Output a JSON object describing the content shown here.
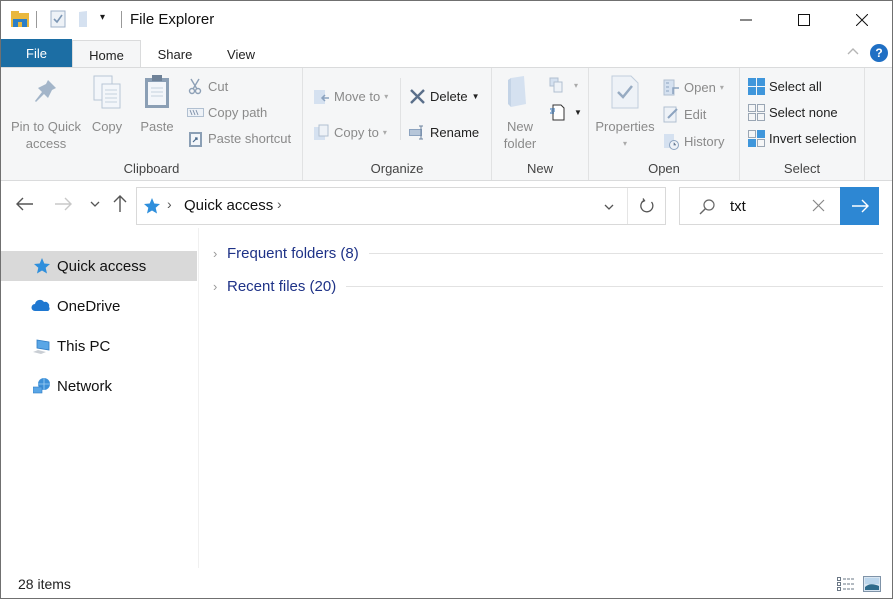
{
  "window": {
    "title": "File Explorer",
    "controls": {
      "minimize": "—",
      "maximize": "☐",
      "close": "✕"
    }
  },
  "quick_access_toolbar": {
    "items": [
      "properties-icon",
      "new-folder-icon",
      "customize-dropdown"
    ]
  },
  "tabs": {
    "file": "File",
    "home": "Home",
    "share": "Share",
    "view": "View",
    "active": "Home"
  },
  "ribbon": {
    "clipboard": {
      "label": "Clipboard",
      "pin": "Pin to Quick access",
      "pin_line1": "Pin to Quick",
      "pin_line2": "access",
      "copy": "Copy",
      "paste": "Paste",
      "cut": "Cut",
      "copy_path": "Copy path",
      "paste_shortcut": "Paste shortcut"
    },
    "organize": {
      "label": "Organize",
      "move_to": "Move to",
      "copy_to": "Copy to",
      "delete": "Delete",
      "rename": "Rename"
    },
    "new": {
      "label": "New",
      "new_folder_line1": "New",
      "new_folder_line2": "folder"
    },
    "open": {
      "label": "Open",
      "properties": "Properties",
      "open": "Open",
      "edit": "Edit",
      "history": "History"
    },
    "select": {
      "label": "Select",
      "select_all": "Select all",
      "select_none": "Select none",
      "invert_selection": "Invert selection"
    }
  },
  "navigation": {
    "back": "←",
    "forward": "→",
    "recent": "⌄",
    "up": "↑",
    "address": {
      "segments": [
        "Quick access"
      ]
    },
    "refresh": "↻",
    "search": {
      "value": "txt",
      "clear": "✕",
      "go": "→"
    }
  },
  "sidebar": {
    "items": [
      {
        "label": "Quick access",
        "icon": "star-icon",
        "selected": true
      },
      {
        "label": "OneDrive",
        "icon": "cloud-icon",
        "selected": false
      },
      {
        "label": "This PC",
        "icon": "computer-icon",
        "selected": false
      },
      {
        "label": "Network",
        "icon": "network-icon",
        "selected": false
      }
    ]
  },
  "content": {
    "sections": [
      {
        "label": "Frequent folders (8)"
      },
      {
        "label": "Recent files (20)"
      }
    ]
  },
  "status": {
    "item_count": "28 items"
  },
  "colors": {
    "file_tab": "#1c6ea4",
    "search_go": "#2d87d3",
    "section_text": "#1e3287",
    "selected_nav": "#d9d9d9"
  }
}
